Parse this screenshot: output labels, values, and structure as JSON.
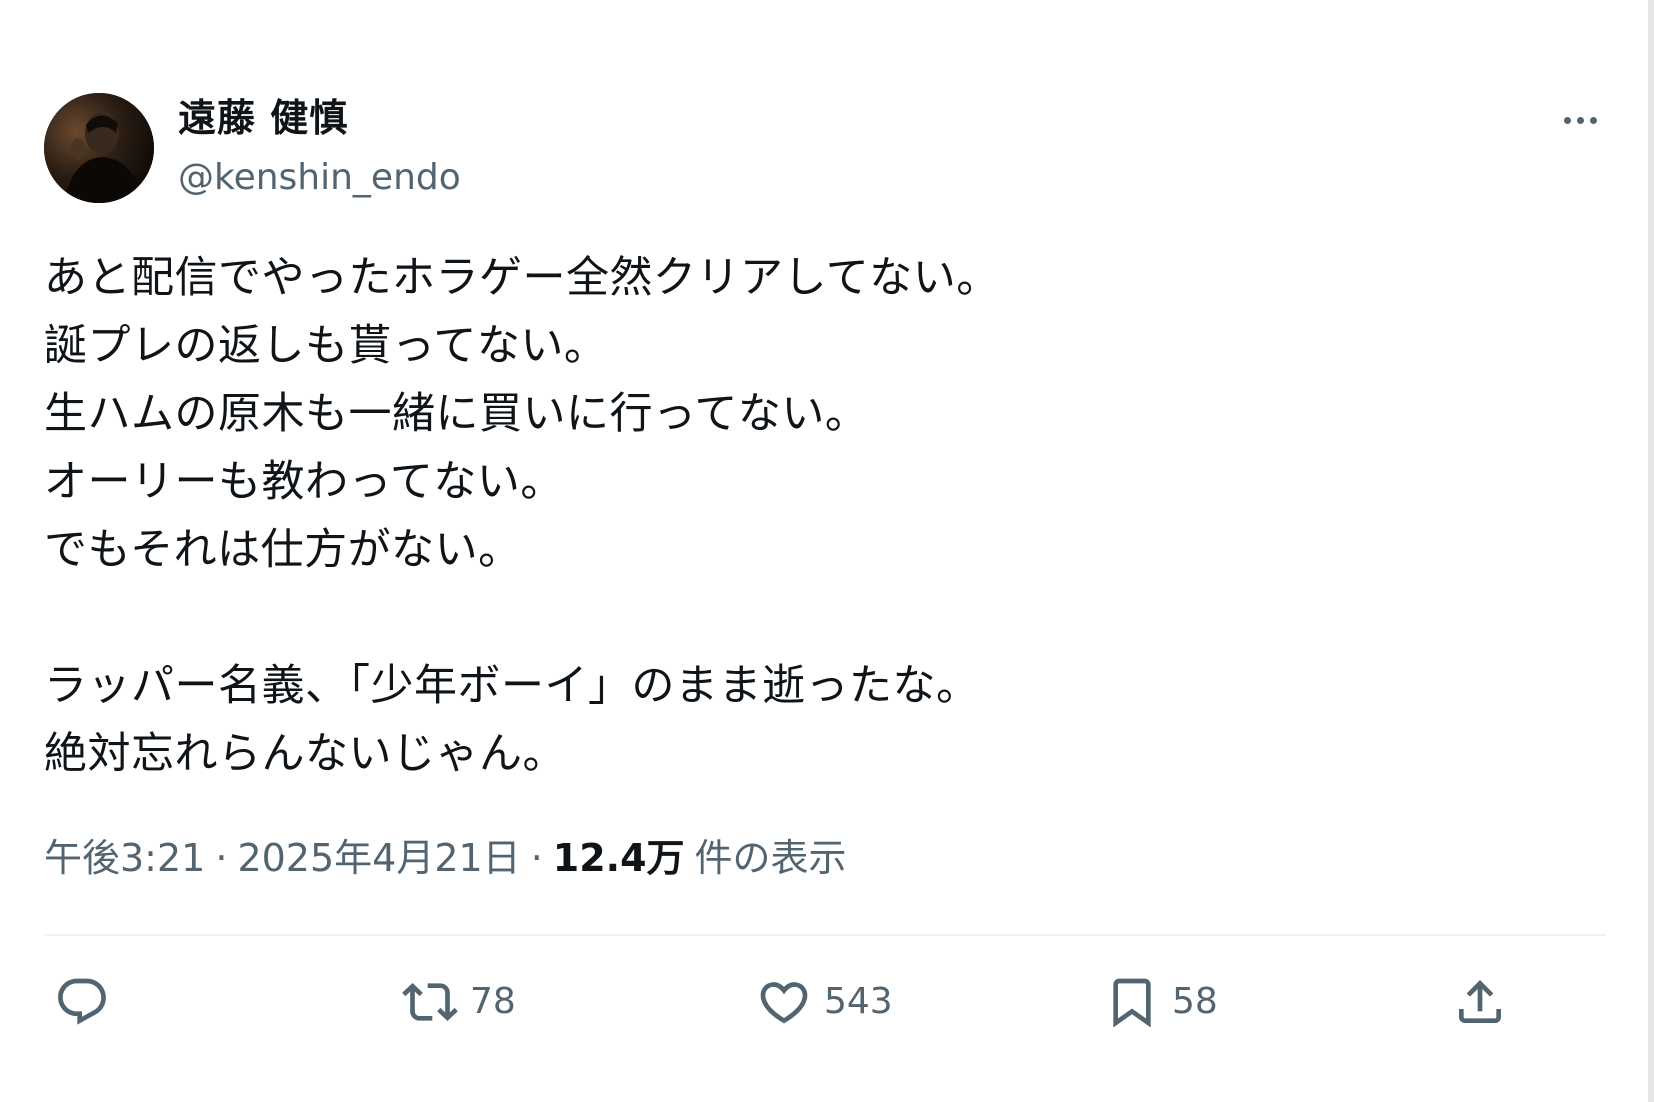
{
  "user": {
    "display_name": "遠藤 健慎",
    "handle": "@kenshin_endo"
  },
  "tweet": {
    "lines": [
      "あと配信でやったホラゲー全然クリアしてない。",
      "誕プレの返しも貰ってない。",
      "生ハムの原木も一緒に買いに行ってない。",
      "オーリーも教わってない。",
      "でもそれは仕方がない。",
      "",
      "ラッパー名義、「少年ボーイ」のまま逝ったな。",
      "絶対忘れらんないじゃん。"
    ]
  },
  "meta": {
    "time": "午後3:21",
    "date": "2025年4月21日",
    "separator": "·",
    "views_count": "12.4万",
    "views_label": "件の表示"
  },
  "actions": {
    "reply": {
      "icon": "reply-icon",
      "count": ""
    },
    "retweet": {
      "icon": "retweet-icon",
      "count": "78"
    },
    "like": {
      "icon": "heart-icon",
      "count": "543"
    },
    "bookmark": {
      "icon": "bookmark-icon",
      "count": "58"
    },
    "share": {
      "icon": "share-icon",
      "count": ""
    }
  },
  "colors": {
    "text": "#0f1419",
    "secondary": "#536471",
    "divider": "#eff3f4",
    "background": "#ffffff"
  }
}
